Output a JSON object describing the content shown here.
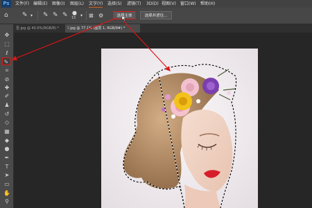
{
  "app": {
    "logo": "Ps"
  },
  "menu": {
    "items": [
      "文件(F)",
      "编辑(E)",
      "图像(I)",
      "图层(L)",
      "文字(Y)",
      "选择(S)",
      "滤镜(T)",
      "3D(D)",
      "视图(V)",
      "窗口(W)",
      "帮助(H)"
    ]
  },
  "options": {
    "brush_size": "15",
    "select_subject_label": "选择主体",
    "select_and_mask_label": "选择并遮住..."
  },
  "tabs": [
    {
      "label": "至.jpg @ 40.6%(RGB/8) *"
    },
    {
      "label": "ﾐ.jpg @ 77.1% (图层 1, RGB/8#) *"
    }
  ],
  "tools": [
    "move-icon",
    "marquee-icon",
    "lasso-icon",
    "quick-selection-icon",
    "crop-icon",
    "eyedropper-icon",
    "healing-icon",
    "brush-icon",
    "clone-stamp-icon",
    "history-brush-icon",
    "eraser-icon",
    "gradient-icon",
    "blur-icon",
    "dodge-icon",
    "pen-icon",
    "type-icon",
    "path-selection-icon",
    "rectangle-icon",
    "hand-icon",
    "zoom-icon"
  ],
  "colors": {
    "annotation": "#e01515",
    "panel": "#474747",
    "canvas": "#262626"
  }
}
